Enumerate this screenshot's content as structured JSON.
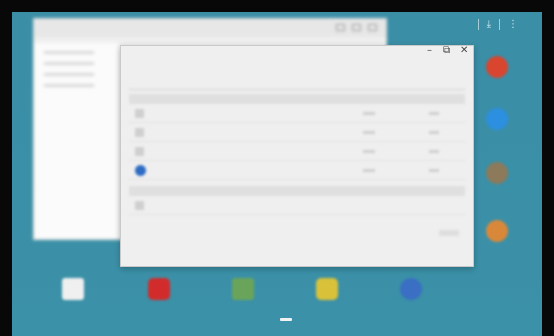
{
  "status_bar": {
    "download_icon": "download-icon",
    "menu_icon": "more-vert-icon"
  },
  "windows": {
    "back": {
      "icon_buttons": [
        "minimize-icon",
        "maximize-icon",
        "close-icon"
      ]
    },
    "front": {
      "controls": {
        "minimize": "–",
        "maximize": "⧉",
        "close": "✕"
      }
    }
  },
  "side_apps": [
    {
      "icon": "red-app-icon",
      "color": "#d9452e"
    },
    {
      "icon": "blue-download-app-icon",
      "color": "#2c8fe0"
    },
    {
      "icon": "multicolor-app-icon",
      "color": "#8c7a5a"
    },
    {
      "icon": "chrome-app-icon",
      "color": "#d9883a"
    }
  ],
  "dock": [
    {
      "icon": "calendar-app-icon",
      "color": "#f0f0f0"
    },
    {
      "icon": "youtube-app-icon",
      "color": "#d22b2b"
    },
    {
      "icon": "maps-app-icon",
      "color": "#6aa45a"
    },
    {
      "icon": "notes-app-icon",
      "color": "#d9c23a"
    },
    {
      "icon": "globe-app-icon",
      "color": "#3a6fc4"
    }
  ],
  "colors": {
    "wallpaper": "#3c8fa6",
    "window_bg": "#efefef"
  }
}
